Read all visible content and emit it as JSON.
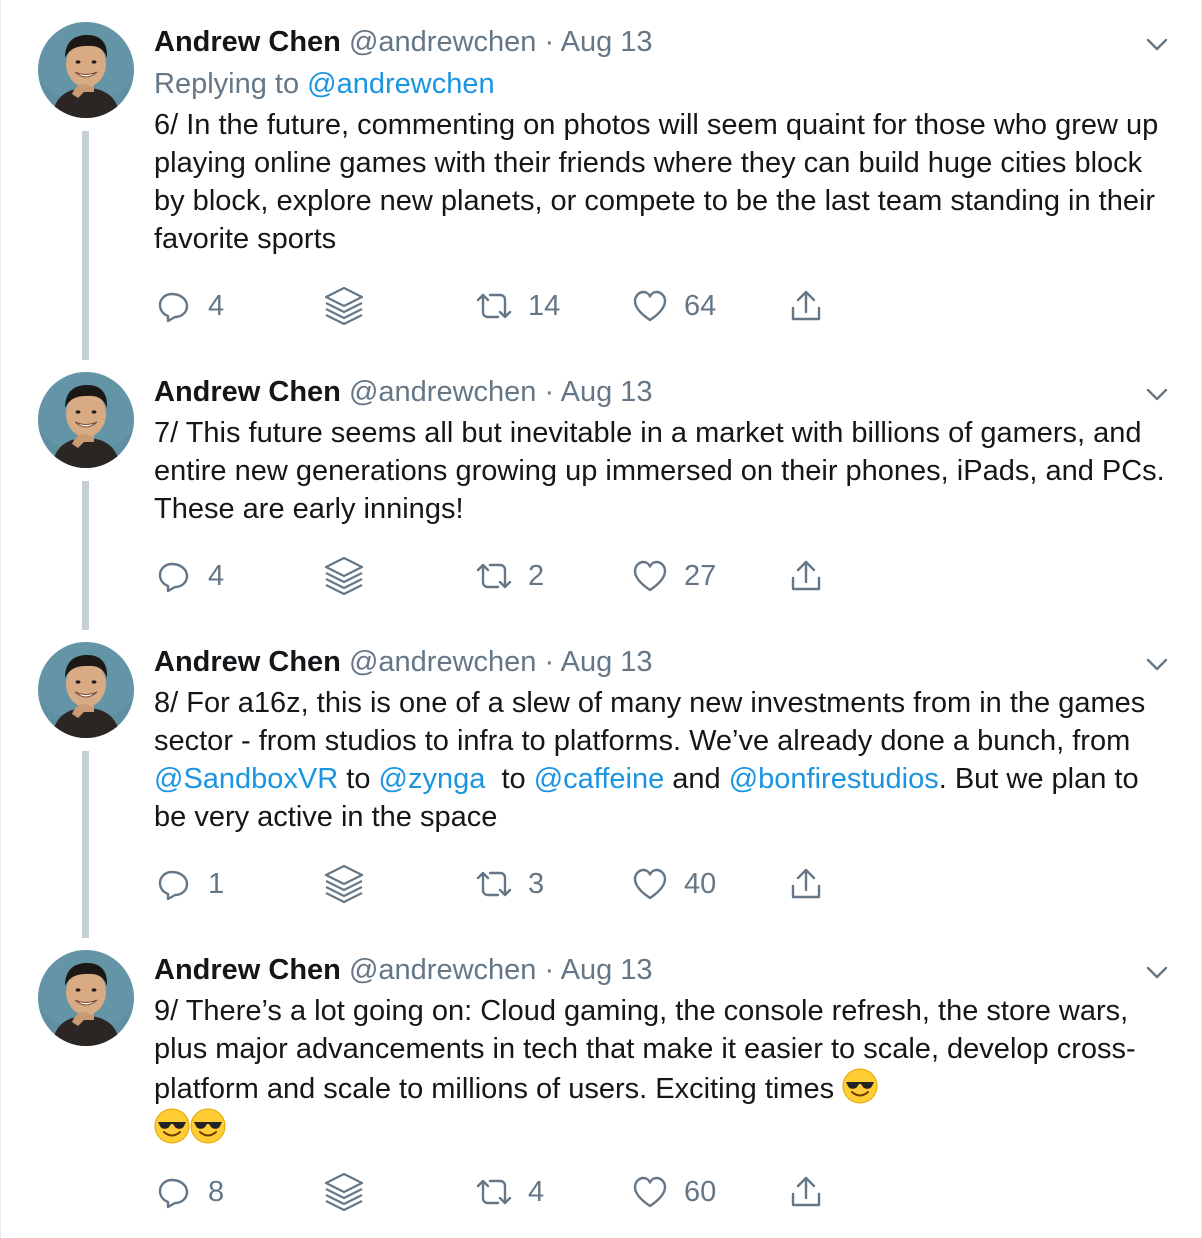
{
  "colors": {
    "link": "#1b95e0",
    "muted": "#657786",
    "text": "#14171a",
    "thread_line": "#c4cfd6"
  },
  "tweets": [
    {
      "author_name": "Andrew Chen",
      "handle": "@andrewchen",
      "separator": "·",
      "date": "Aug 13",
      "replying_prefix": "Replying to",
      "replying_to": "@andrewchen",
      "text_parts": [
        "6/ In the future, commenting on photos will seem quaint for those who grew up playing online games with their friends where they can build huge cities block by block, explore new planets, or compete to be the last team standing in their favorite sports"
      ],
      "replies": "4",
      "retweets": "14",
      "likes": "64"
    },
    {
      "author_name": "Andrew Chen",
      "handle": "@andrewchen",
      "separator": "·",
      "date": "Aug 13",
      "text_parts": [
        "7/ This future seems all but inevitable in a market with billions of gamers, and entire new generations growing up immersed on their phones, iPads, and PCs. These are early innings!"
      ],
      "replies": "4",
      "retweets": "2",
      "likes": "27"
    },
    {
      "author_name": "Andrew Chen",
      "handle": "@andrewchen",
      "separator": "·",
      "date": "Aug 13",
      "text_parts": [
        "8/ For a16z, this is one of a slew of many new investments from in the games sector - from studios to infra to platforms. We’ve already done a bunch, from ",
        "@SandboxVR",
        " to ",
        "@zynga",
        "  to ",
        "@caffeine",
        " and ",
        "@bonfirestudios",
        ". But we plan to be very active in the space"
      ],
      "replies": "1",
      "retweets": "3",
      "likes": "40"
    },
    {
      "author_name": "Andrew Chen",
      "handle": "@andrewchen",
      "separator": "·",
      "date": "Aug 13",
      "text_parts": [
        "9/ There’s a lot going on: Cloud gaming, the console refresh, the store wars, plus major advancements in tech that make it easier to scale, develop cross-platform and scale to millions of users. Exciting times "
      ],
      "emoji": "smiling-face-with-sunglasses",
      "replies": "8",
      "retweets": "4",
      "likes": "60"
    }
  ]
}
